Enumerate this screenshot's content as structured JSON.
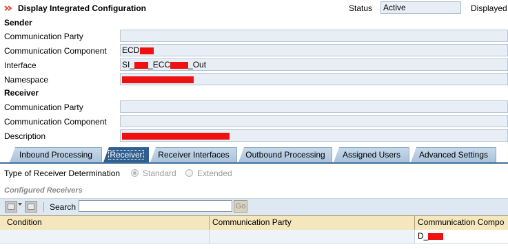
{
  "header": {
    "title": "Display Integrated Configuration",
    "status_label": "Status",
    "status_value": "Active",
    "mode_label": "Displayed"
  },
  "sender": {
    "heading": "Sender",
    "rows": [
      {
        "label": "Communication Party",
        "value": ""
      },
      {
        "label": "Communication Component",
        "value": "ECD"
      },
      {
        "label": "Interface",
        "value_parts": [
          "SI_",
          "_ECC",
          "_Out"
        ]
      },
      {
        "label": "Namespace",
        "value": ""
      }
    ]
  },
  "receiver": {
    "heading": "Receiver",
    "rows": [
      {
        "label": "Communication Party",
        "value": ""
      },
      {
        "label": "Communication Component",
        "value": ""
      },
      {
        "label": "Description",
        "value": ""
      }
    ]
  },
  "tabs": [
    {
      "label": "Inbound Processing",
      "active": false
    },
    {
      "label": "Receiver",
      "active": true
    },
    {
      "label": "Receiver Interfaces",
      "active": false
    },
    {
      "label": "Outbound Processing",
      "active": false
    },
    {
      "label": "Assigned Users",
      "active": false
    },
    {
      "label": "Advanced Settings",
      "active": false
    }
  ],
  "receiver_tab": {
    "determination_label": "Type of Receiver Determination",
    "options": [
      {
        "label": "Standard",
        "selected": true
      },
      {
        "label": "Extended",
        "selected": false
      }
    ],
    "configured_heading": "Configured Receivers",
    "search_label": "Search",
    "search_value": "",
    "go_label": "Go",
    "columns": [
      "Condition",
      "Communication Party",
      "Communication Compo"
    ],
    "rows": [
      {
        "condition": "",
        "party": "",
        "component": "D_"
      }
    ]
  },
  "colors": {
    "accent": "#2f5f8f",
    "field_bg": "#e7eef5",
    "redaction": "#ee1111",
    "table_header": "#f4e6bd"
  }
}
